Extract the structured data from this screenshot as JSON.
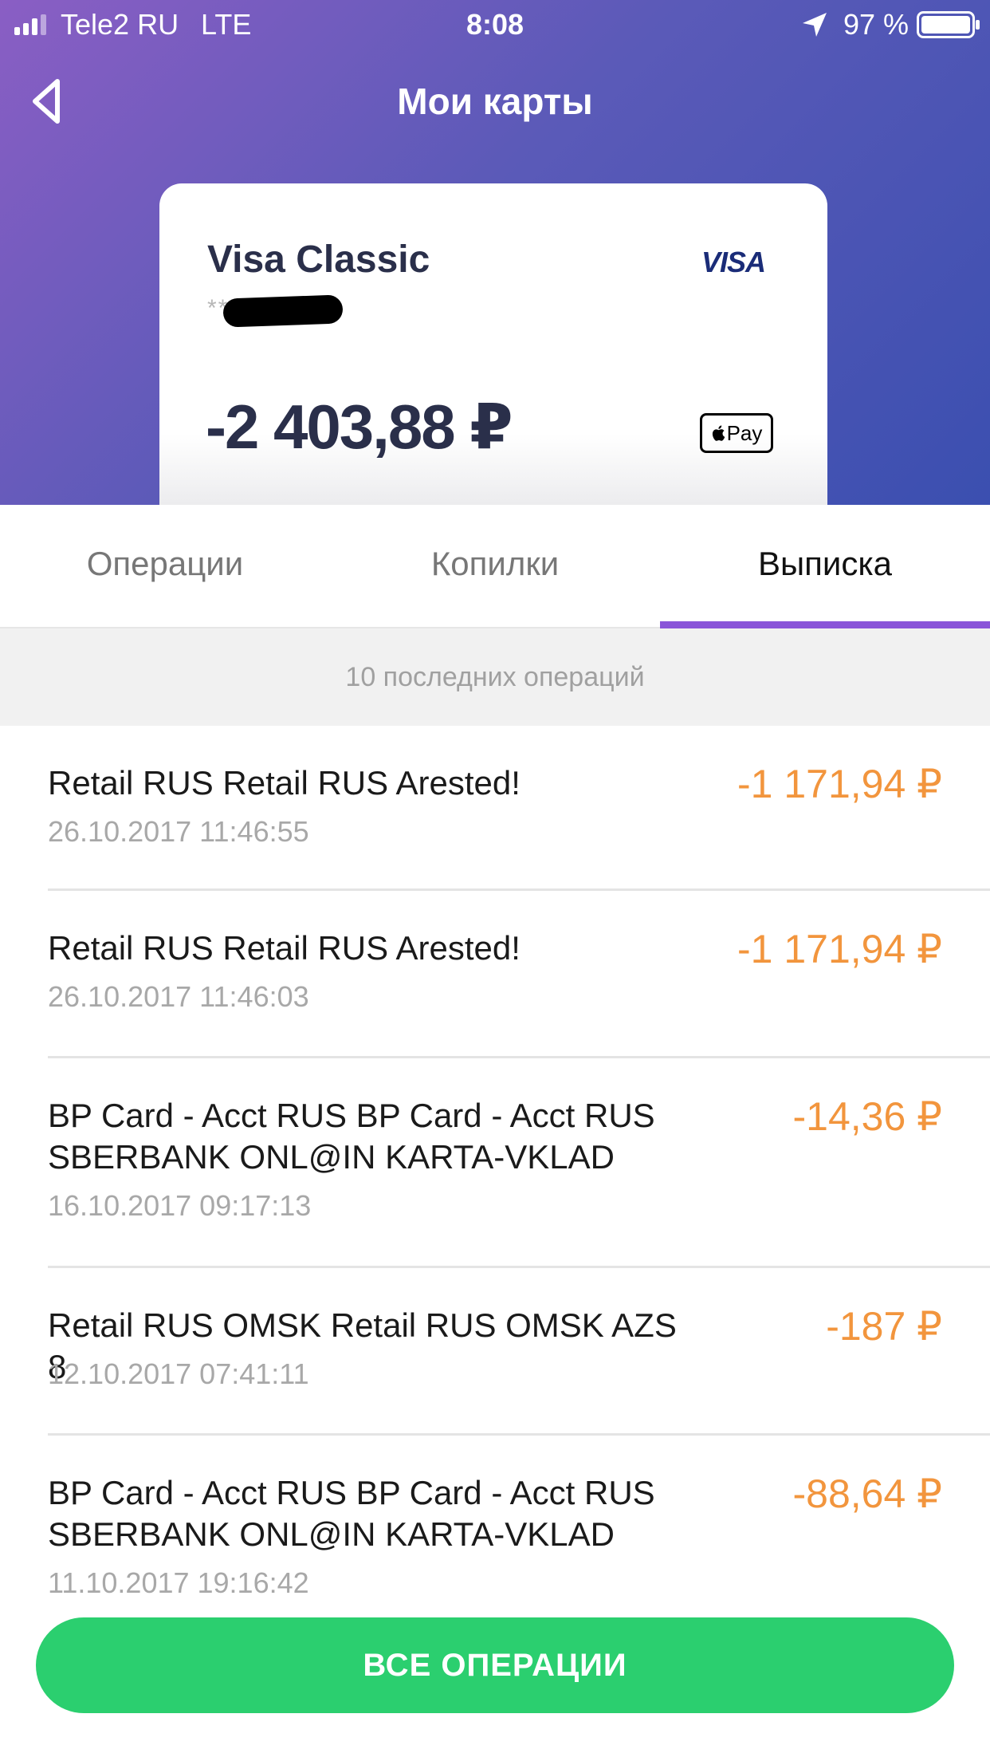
{
  "status_bar": {
    "carrier": "Tele2 RU",
    "network": "LTE",
    "time": "8:08",
    "battery": "97 %"
  },
  "header": {
    "title": "Мои карты"
  },
  "card": {
    "name": "Visa Classic",
    "number_masked": "**",
    "brand": "VISA",
    "balance": "-2 403,88 ₽",
    "wallet_badge": "Pay"
  },
  "tabs": [
    {
      "label": "Операции",
      "active": false
    },
    {
      "label": "Копилки",
      "active": false
    },
    {
      "label": "Выписка",
      "active": true
    }
  ],
  "section_title": "10 последних операций",
  "transactions": [
    {
      "description": "Retail RUS Retail RUS Arested!",
      "date": "26.10.2017  11:46:55",
      "amount": "-1 171,94 ₽"
    },
    {
      "description": "Retail RUS Retail RUS Arested!",
      "date": "26.10.2017  11:46:03",
      "amount": "-1 171,94 ₽"
    },
    {
      "description": "BP Card - Acct RUS BP Card - Acct RUS SBERBANK ONL@IN KARTA-VKLAD",
      "date": "16.10.2017  09:17:13",
      "amount": "-14,36 ₽"
    },
    {
      "description": "Retail RUS OMSK Retail RUS OMSK AZS 8",
      "date": "12.10.2017  07:41:11",
      "amount": "-187 ₽"
    },
    {
      "description": "BP Card - Acct RUS BP Card - Acct RUS SBERBANK ONL@IN KARTA-VKLAD",
      "date": "11.10.2017  19:16:42",
      "amount": "-88,64 ₽"
    }
  ],
  "cta": {
    "label": "ВСЕ ОПЕРАЦИИ"
  },
  "colors": {
    "accent": "#8a55d8",
    "amount": "#f2953d",
    "cta": "#2bcf6f"
  }
}
